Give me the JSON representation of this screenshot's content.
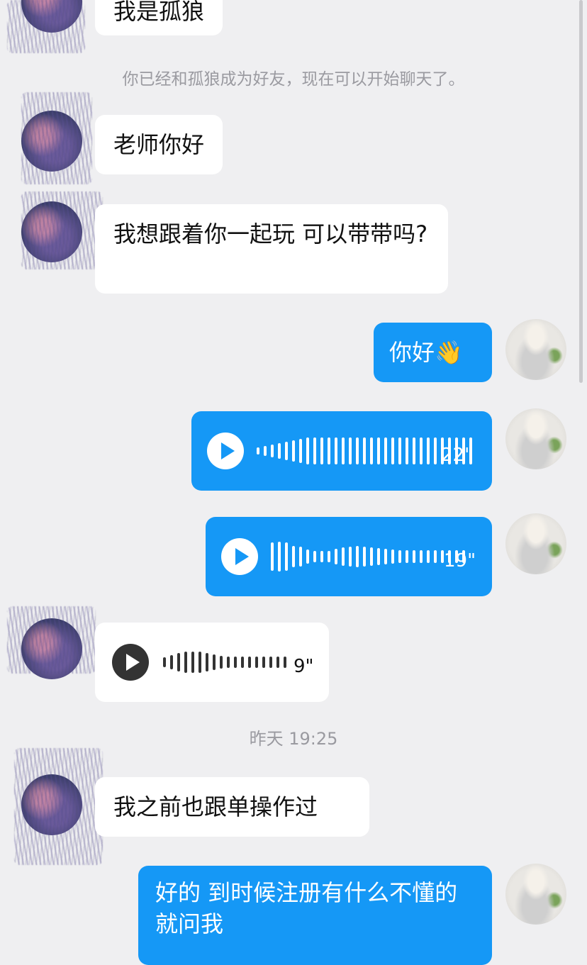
{
  "messages": {
    "m0": {
      "text": "我是孤狼"
    },
    "sys_friend": {
      "text": "你已经和孤狼成为好友，现在可以开始聊天了。"
    },
    "m1": {
      "text": "老师你好"
    },
    "m2": {
      "text": "我想跟着你一起玩 可以带带吗?"
    },
    "m3": {
      "text": "你好👋"
    },
    "v1": {
      "duration": "22\"",
      "bars": [
        10,
        14,
        18,
        22,
        26,
        30,
        34,
        38,
        38,
        38,
        38,
        38,
        38,
        38,
        38,
        38,
        38,
        38,
        38,
        38,
        38,
        38,
        38,
        38,
        38,
        38,
        38,
        38,
        38,
        38,
        38
      ]
    },
    "v2": {
      "duration": "19\"",
      "bars": [
        40,
        42,
        40,
        30,
        28,
        20,
        16,
        16,
        16,
        22,
        26,
        28,
        30,
        28,
        26,
        24,
        22,
        20,
        18,
        18,
        18,
        18,
        18,
        18,
        18,
        18,
        18,
        18
      ]
    },
    "v3": {
      "duration": "9\"",
      "bars": [
        14,
        20,
        26,
        30,
        30,
        30,
        26,
        22,
        18,
        16,
        16,
        16,
        16,
        16,
        16,
        16,
        16,
        16
      ]
    },
    "time_sep": {
      "text": "昨天 19:25"
    },
    "m4": {
      "text": "我之前也跟单操作过"
    },
    "m5": {
      "text": "好的 到时候注册有什么不懂的就问我"
    }
  },
  "icons": {
    "play": "play-icon"
  },
  "colors": {
    "outgoing": "#1598f6",
    "incoming": "#ffffff",
    "background": "#efeff1"
  }
}
